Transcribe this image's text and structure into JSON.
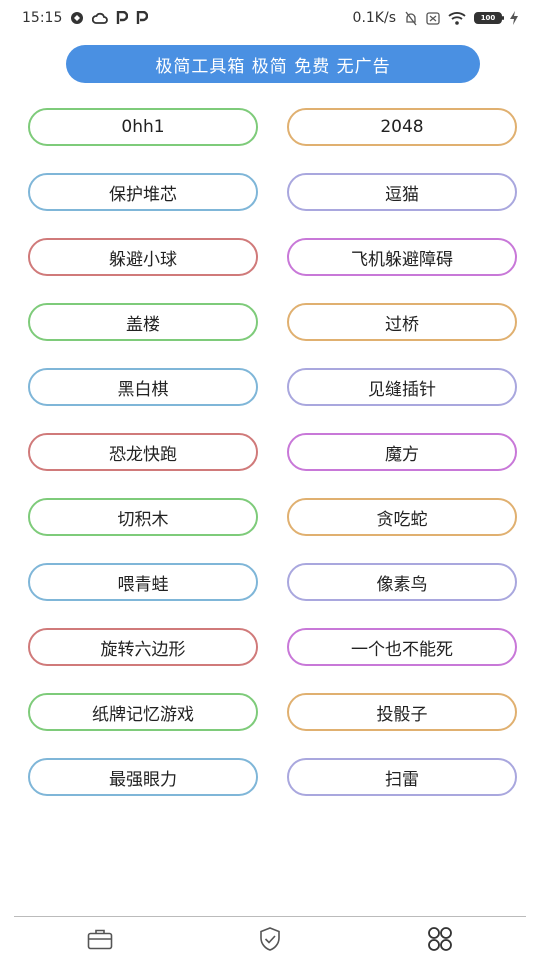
{
  "status_bar": {
    "time": "15:15",
    "net_speed": "0.1K/s",
    "battery_level": "100",
    "left_icons": [
      "app-notification-icon",
      "cloud-icon",
      "p-app-icon",
      "p-app-icon-2"
    ],
    "right_icons": [
      "mute-bell-icon",
      "sim-icon",
      "wifi-icon",
      "battery-icon",
      "charging-icon"
    ]
  },
  "banner": {
    "text": "极简工具箱 极简 免费 无广告",
    "color": "#4a90e2"
  },
  "games": [
    {
      "label": "0hh1",
      "border_color": "#7ecb7a"
    },
    {
      "label": "2048",
      "border_color": "#e0b070"
    },
    {
      "label": "保护堆芯",
      "border_color": "#7fb6d8"
    },
    {
      "label": "逗猫",
      "border_color": "#a9a7de"
    },
    {
      "label": "躲避小球",
      "border_color": "#d07a7a"
    },
    {
      "label": "飞机躲避障碍",
      "border_color": "#c878d8"
    },
    {
      "label": "盖楼",
      "border_color": "#7ecb7a"
    },
    {
      "label": "过桥",
      "border_color": "#e0b070"
    },
    {
      "label": "黑白棋",
      "border_color": "#7fb6d8"
    },
    {
      "label": "见缝插针",
      "border_color": "#a9a7de"
    },
    {
      "label": "恐龙快跑",
      "border_color": "#d07a7a"
    },
    {
      "label": "魔方",
      "border_color": "#c878d8"
    },
    {
      "label": "切积木",
      "border_color": "#7ecb7a"
    },
    {
      "label": "贪吃蛇",
      "border_color": "#e0b070"
    },
    {
      "label": "喂青蛙",
      "border_color": "#7fb6d8"
    },
    {
      "label": "像素鸟",
      "border_color": "#a9a7de"
    },
    {
      "label": "旋转六边形",
      "border_color": "#d07a7a"
    },
    {
      "label": "一个也不能死",
      "border_color": "#c878d8"
    },
    {
      "label": "纸牌记忆游戏",
      "border_color": "#7ecb7a"
    },
    {
      "label": "投骰子",
      "border_color": "#e0b070"
    },
    {
      "label": "最强眼力",
      "border_color": "#7fb6d8"
    },
    {
      "label": "扫雷",
      "border_color": "#a9a7de"
    }
  ],
  "bottom_nav": {
    "items": [
      {
        "icon": "toolbox-icon"
      },
      {
        "icon": "shield-check-icon"
      },
      {
        "icon": "apps-grid-icon"
      }
    ],
    "active_color": "#333333",
    "inactive_color": "#555555"
  }
}
